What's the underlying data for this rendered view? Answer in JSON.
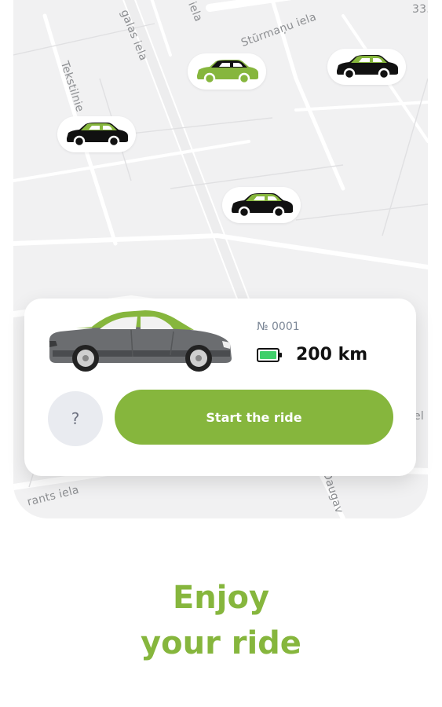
{
  "map": {
    "streets": {
      "galas": "galas iela",
      "sturmanu": "Stūrmaņu iela",
      "tekstilnieku": "Tekstilnie",
      "top_fragment": "iela",
      "corner_number": "33.",
      "rants": "rants iela",
      "daugav": "Daugav",
      "el_fragment": "el"
    },
    "markers": [
      {
        "name": "car-marker-1",
        "body_color": "#86b63d",
        "roof_color": "#111111"
      },
      {
        "name": "car-marker-2",
        "body_color": "#111111",
        "roof_color": "#86b63d"
      },
      {
        "name": "car-marker-3",
        "body_color": "#111111",
        "roof_color": "#86b63d"
      },
      {
        "name": "car-marker-4",
        "body_color": "#111111",
        "roof_color": "#86b63d"
      }
    ]
  },
  "card": {
    "car_number": "№ 0001",
    "range": "200 km",
    "battery_icon": "battery-icon",
    "help_label": "?",
    "start_label": "Start the ride"
  },
  "headline": {
    "line1": "Enjoy",
    "line2": "your ride"
  },
  "colors": {
    "accent": "#86b63d",
    "map_background": "#f1f1f2",
    "help_button": "#e9ebf0"
  }
}
